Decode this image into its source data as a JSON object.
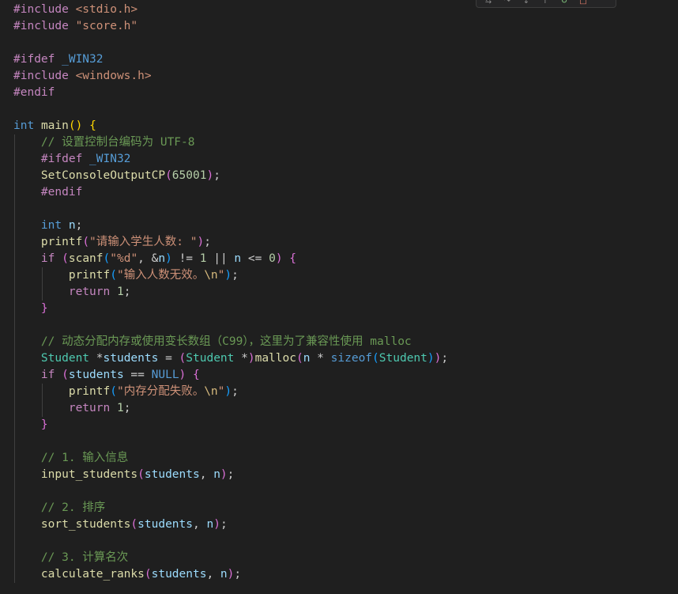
{
  "editor": {
    "toolbar": {
      "icons": [
        "continue-icon",
        "step-over-icon",
        "step-into-icon",
        "step-out-icon",
        "restart-icon",
        "stop-icon"
      ],
      "glyphs": [
        "⇆",
        "↷",
        "↓",
        "↑",
        "↻",
        "□"
      ]
    },
    "lines": [
      [
        [
          "pp",
          "#include "
        ],
        [
          "str",
          "<stdio.h>"
        ]
      ],
      [
        [
          "pp",
          "#include "
        ],
        [
          "str",
          "\"score.h\""
        ]
      ],
      [],
      [
        [
          "pp",
          "#ifdef "
        ],
        [
          "mac",
          "_WIN32"
        ]
      ],
      [
        [
          "pp",
          "#include "
        ],
        [
          "str",
          "<windows.h>"
        ]
      ],
      [
        [
          "pp",
          "#endif"
        ]
      ],
      [],
      [
        [
          "kw",
          "int"
        ],
        [
          "",
          " "
        ],
        [
          "fn",
          "main"
        ],
        [
          "b1",
          "()"
        ],
        [
          "",
          " "
        ],
        [
          "b1",
          "{"
        ]
      ],
      [
        [
          "",
          "    "
        ],
        [
          "cmt",
          "// 设置控制台编码为 UTF-8"
        ]
      ],
      [
        [
          "",
          "    "
        ],
        [
          "pp",
          "#ifdef "
        ],
        [
          "mac",
          "_WIN32"
        ]
      ],
      [
        [
          "",
          "    "
        ],
        [
          "fn",
          "SetConsoleOutputCP"
        ],
        [
          "b2",
          "("
        ],
        [
          "num",
          "65001"
        ],
        [
          "b2",
          ")"
        ],
        [
          "",
          ";"
        ]
      ],
      [
        [
          "",
          "    "
        ],
        [
          "pp",
          "#endif"
        ]
      ],
      [],
      [
        [
          "",
          "    "
        ],
        [
          "kw",
          "int"
        ],
        [
          "",
          " "
        ],
        [
          "var",
          "n"
        ],
        [
          "",
          ";"
        ]
      ],
      [
        [
          "",
          "    "
        ],
        [
          "fn",
          "printf"
        ],
        [
          "b2",
          "("
        ],
        [
          "str",
          "\"请输入学生人数: \""
        ],
        [
          "b2",
          ")"
        ],
        [
          "",
          ";"
        ]
      ],
      [
        [
          "",
          "    "
        ],
        [
          "ctl",
          "if"
        ],
        [
          "",
          " "
        ],
        [
          "b2",
          "("
        ],
        [
          "fn",
          "scanf"
        ],
        [
          "b3",
          "("
        ],
        [
          "str",
          "\"%d\""
        ],
        [
          "",
          ", &"
        ],
        [
          "var",
          "n"
        ],
        [
          "b3",
          ")"
        ],
        [
          "",
          " != "
        ],
        [
          "num",
          "1"
        ],
        [
          "",
          " || "
        ],
        [
          "var",
          "n"
        ],
        [
          "",
          " <= "
        ],
        [
          "num",
          "0"
        ],
        [
          "b2",
          ")"
        ],
        [
          "",
          " "
        ],
        [
          "b2",
          "{"
        ]
      ],
      [
        [
          "",
          "        "
        ],
        [
          "fn",
          "printf"
        ],
        [
          "b3",
          "("
        ],
        [
          "str",
          "\"输入人数无效。"
        ],
        [
          "esc",
          "\\n"
        ],
        [
          "str",
          "\""
        ],
        [
          "b3",
          ")"
        ],
        [
          "",
          ";"
        ]
      ],
      [
        [
          "",
          "        "
        ],
        [
          "ctl",
          "return"
        ],
        [
          "",
          " "
        ],
        [
          "num",
          "1"
        ],
        [
          "",
          ";"
        ]
      ],
      [
        [
          "",
          "    "
        ],
        [
          "b2",
          "}"
        ]
      ],
      [],
      [
        [
          "",
          "    "
        ],
        [
          "cmt",
          "// 动态分配内存或使用变长数组（C99），这里为了兼容性使用 malloc"
        ]
      ],
      [
        [
          "",
          "    "
        ],
        [
          "typ",
          "Student"
        ],
        [
          "",
          " *"
        ],
        [
          "var",
          "students"
        ],
        [
          "",
          " = "
        ],
        [
          "b2",
          "("
        ],
        [
          "typ",
          "Student"
        ],
        [
          "",
          " *"
        ],
        [
          "b2",
          ")"
        ],
        [
          "fn",
          "malloc"
        ],
        [
          "b2",
          "("
        ],
        [
          "var",
          "n"
        ],
        [
          "",
          " * "
        ],
        [
          "kw",
          "sizeof"
        ],
        [
          "b3",
          "("
        ],
        [
          "typ",
          "Student"
        ],
        [
          "b3",
          ")"
        ],
        [
          "b2",
          ")"
        ],
        [
          "",
          ";"
        ]
      ],
      [
        [
          "",
          "    "
        ],
        [
          "ctl",
          "if"
        ],
        [
          "",
          " "
        ],
        [
          "b2",
          "("
        ],
        [
          "var",
          "students"
        ],
        [
          "",
          " == "
        ],
        [
          "mac",
          "NULL"
        ],
        [
          "b2",
          ")"
        ],
        [
          "",
          " "
        ],
        [
          "b2",
          "{"
        ]
      ],
      [
        [
          "",
          "        "
        ],
        [
          "fn",
          "printf"
        ],
        [
          "b3",
          "("
        ],
        [
          "str",
          "\"内存分配失败。"
        ],
        [
          "esc",
          "\\n"
        ],
        [
          "str",
          "\""
        ],
        [
          "b3",
          ")"
        ],
        [
          "",
          ";"
        ]
      ],
      [
        [
          "",
          "        "
        ],
        [
          "ctl",
          "return"
        ],
        [
          "",
          " "
        ],
        [
          "num",
          "1"
        ],
        [
          "",
          ";"
        ]
      ],
      [
        [
          "",
          "    "
        ],
        [
          "b2",
          "}"
        ]
      ],
      [],
      [
        [
          "",
          "    "
        ],
        [
          "cmt",
          "// 1. 输入信息"
        ]
      ],
      [
        [
          "",
          "    "
        ],
        [
          "fn",
          "input_students"
        ],
        [
          "b2",
          "("
        ],
        [
          "var",
          "students"
        ],
        [
          "",
          ", "
        ],
        [
          "var",
          "n"
        ],
        [
          "b2",
          ")"
        ],
        [
          "",
          ";"
        ]
      ],
      [],
      [
        [
          "",
          "    "
        ],
        [
          "cmt",
          "// 2. 排序"
        ]
      ],
      [
        [
          "",
          "    "
        ],
        [
          "fn",
          "sort_students"
        ],
        [
          "b2",
          "("
        ],
        [
          "var",
          "students"
        ],
        [
          "",
          ", "
        ],
        [
          "var",
          "n"
        ],
        [
          "b2",
          ")"
        ],
        [
          "",
          ";"
        ]
      ],
      [],
      [
        [
          "",
          "    "
        ],
        [
          "cmt",
          "// 3. 计算名次"
        ]
      ],
      [
        [
          "",
          "    "
        ],
        [
          "fn",
          "calculate_ranks"
        ],
        [
          "b2",
          "("
        ],
        [
          "var",
          "students"
        ],
        [
          "",
          ", "
        ],
        [
          "var",
          "n"
        ],
        [
          "b2",
          ")"
        ],
        [
          "",
          ";"
        ]
      ]
    ],
    "guides": [
      0,
      0,
      0,
      0,
      0,
      0,
      0,
      0,
      1,
      1,
      1,
      1,
      1,
      1,
      1,
      1,
      2,
      2,
      1,
      1,
      1,
      1,
      1,
      2,
      2,
      1,
      1,
      1,
      1,
      1,
      1,
      1,
      1,
      1,
      1
    ]
  }
}
